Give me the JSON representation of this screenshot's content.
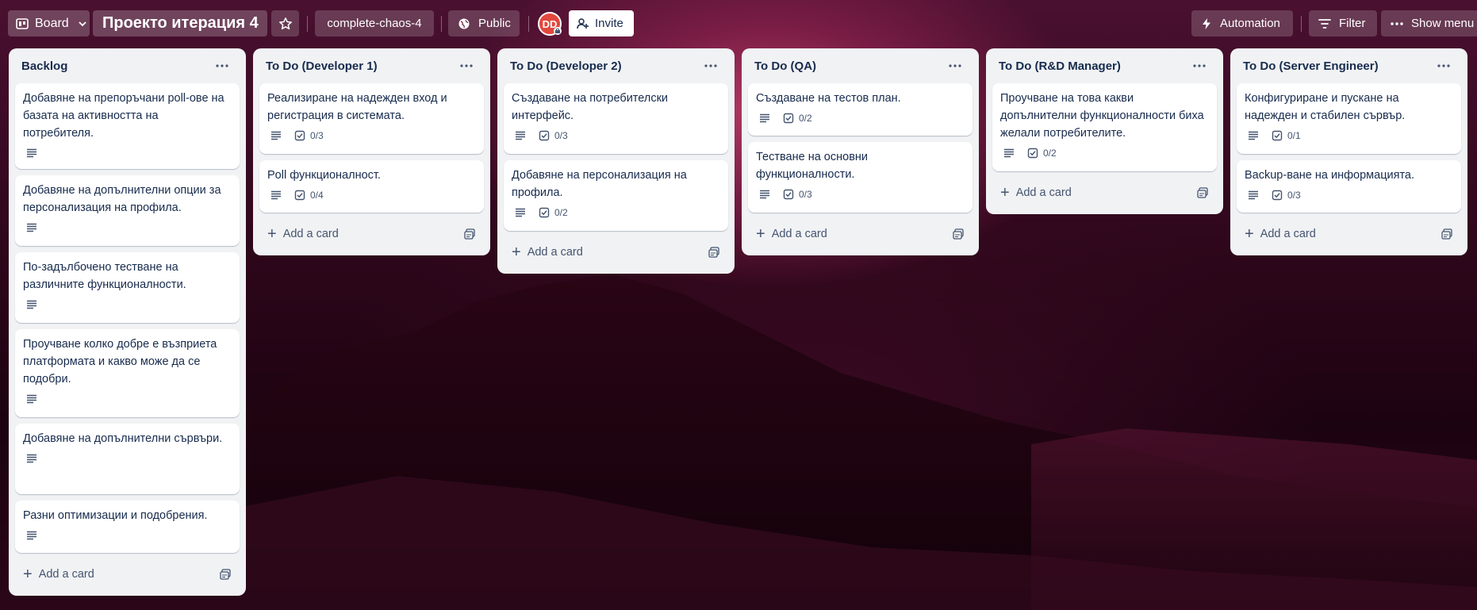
{
  "topbar": {
    "board_view": "Board",
    "board_title": "Проекто итерация 4",
    "workspace": "complete-chaos-4",
    "visibility": "Public",
    "avatar_initials": "DD",
    "invite": "Invite",
    "automation": "Automation",
    "filter": "Filter",
    "show_menu": "Show menu"
  },
  "add_card_label": "Add a card",
  "lists": [
    {
      "title": "Backlog",
      "cards": [
        {
          "text": "Добавяне на препоръчани poll-ове на базата на активността на потребителя.",
          "checklist": ""
        },
        {
          "text": "Добавяне на допълнителни опции за персонализация на профила.",
          "checklist": ""
        },
        {
          "text": "По-задълбочено тестване на различните функционалности.",
          "checklist": ""
        },
        {
          "text": "Проучване колко добре е възприета платформата и какво може да се подобри.",
          "checklist": ""
        },
        {
          "text": "Добавяне на допълнителни сървъри.",
          "checklist": ""
        },
        {
          "text": "Разни оптимизации и подобрения.",
          "checklist": ""
        }
      ]
    },
    {
      "title": "To Do (Developer 1)",
      "cards": [
        {
          "text": "Реализиране на надежден вход и регистрация в системата.",
          "checklist": "0/3"
        },
        {
          "text": "Poll функционалност.",
          "checklist": "0/4"
        }
      ]
    },
    {
      "title": "To Do (Developer 2)",
      "cards": [
        {
          "text": "Създаване на потребителски интерфейс.",
          "checklist": "0/3"
        },
        {
          "text": "Добавяне на персонализация на профила.",
          "checklist": "0/2"
        }
      ]
    },
    {
      "title": "To Do (QA)",
      "cards": [
        {
          "text": "Създаване на тестов план.",
          "checklist": "0/2"
        },
        {
          "text": "Тестване на основни функционалности.",
          "checklist": "0/3"
        }
      ]
    },
    {
      "title": "To Do (R&D Manager)",
      "cards": [
        {
          "text": "Проучване на това какви допълнителни функционалности биха желали потребителите.",
          "checklist": "0/2"
        }
      ]
    },
    {
      "title": "To Do (Server Engineer)",
      "cards": [
        {
          "text": "Конфигуриране и пускане на надежден и стабилен сървър.",
          "checklist": "0/1"
        },
        {
          "text": "Backup-ване на информацията.",
          "checklist": "0/3"
        }
      ]
    }
  ]
}
